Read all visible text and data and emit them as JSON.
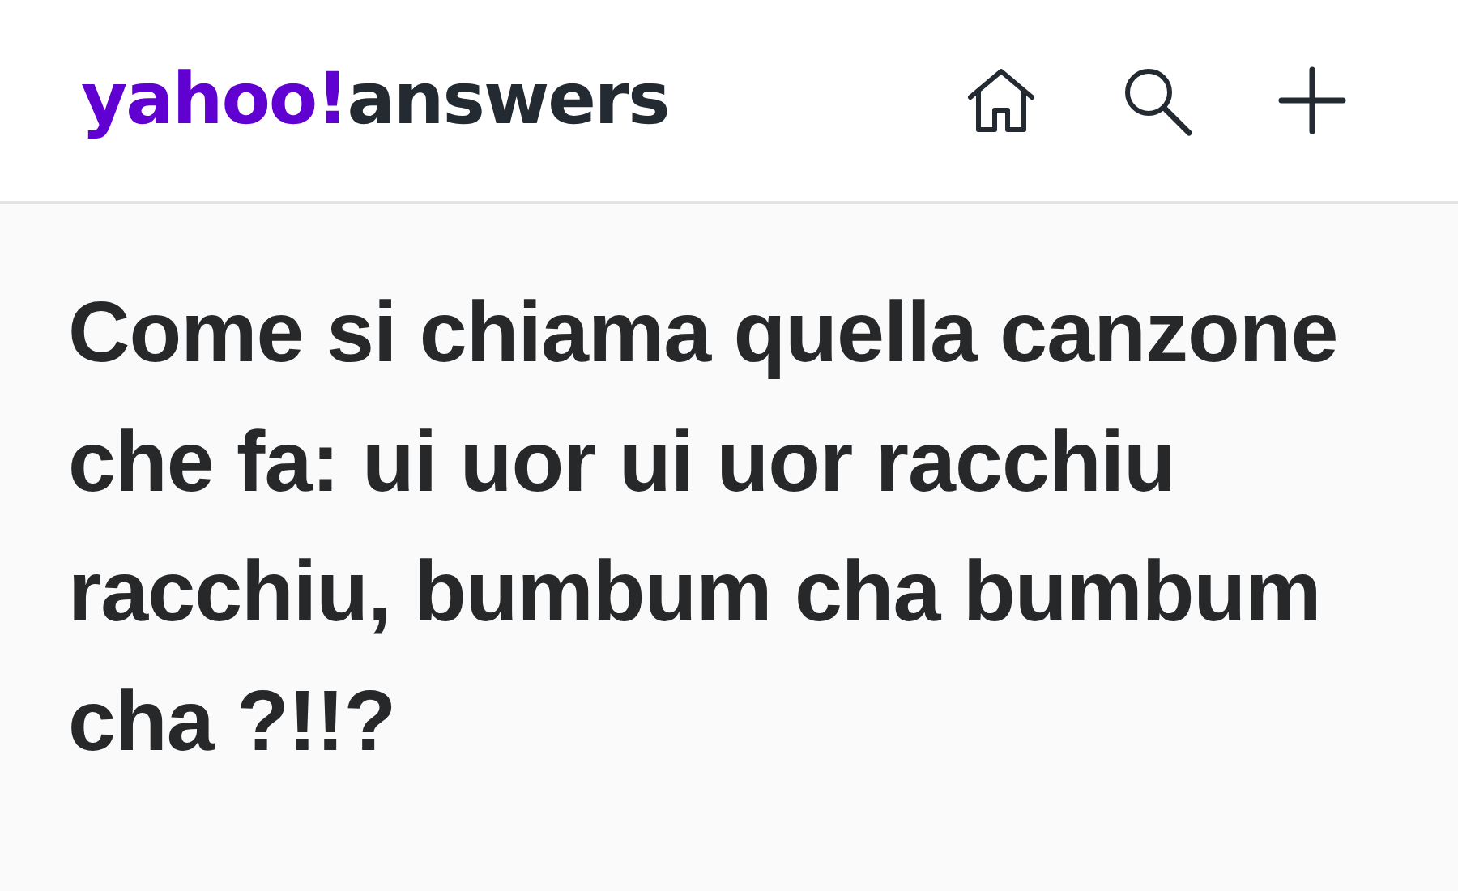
{
  "header": {
    "logo": {
      "brand": "yahoo!",
      "product": "answers"
    },
    "nav_icons": [
      {
        "kind": "home"
      },
      {
        "kind": "search"
      },
      {
        "kind": "add"
      }
    ]
  },
  "question": {
    "title": "Come si chiama quella canzone che fa: ui uor ui uor racchiu racchiu, bumbum cha bumbum cha ?!!?"
  }
}
